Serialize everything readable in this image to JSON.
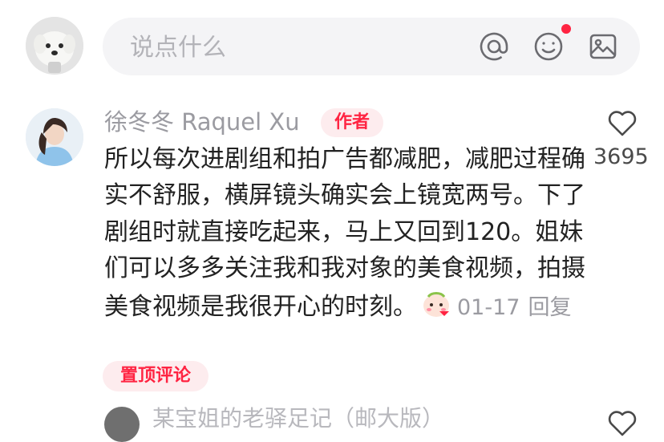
{
  "composer": {
    "placeholder": "说点什么",
    "icons": [
      "at-icon",
      "emoji-icon",
      "image-icon"
    ],
    "emoji_has_notification_dot": true
  },
  "comment": {
    "author": "徐冬冬 Raquel Xu",
    "author_badge": "作者",
    "text": "所以每次进剧组和拍广告都减肥，减肥过程确实不舒服，横屏镜头确实会上镜宽两号。下了剧组时就直接吃起来，马上又回到120。姐妹们可以多多关注我和我对象的美食视频，拍摄美食视频是我很开心的时刻。",
    "date": "01-17",
    "reply_label": "回复",
    "likes": "3695",
    "pinned_label": "置顶评论"
  },
  "next_comment": {
    "author_partial": "某宝姐的老驿足记（邮大版）"
  },
  "colors": {
    "accent": "#ff2442",
    "badge_bg": "#fdecee",
    "input_bg": "#f4f4f6",
    "muted_text": "#9b9ba1"
  }
}
